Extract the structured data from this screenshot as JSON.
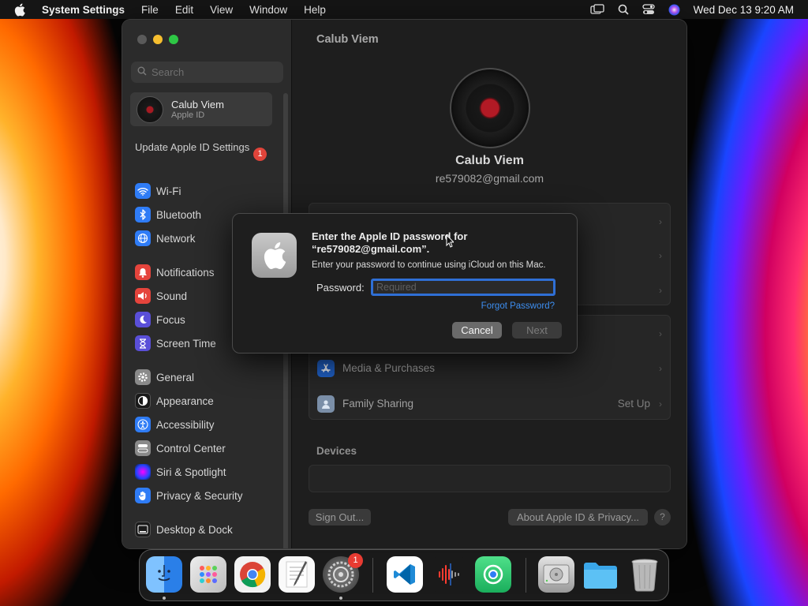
{
  "menubar": {
    "app_name": "System Settings",
    "items": [
      "File",
      "Edit",
      "View",
      "Window",
      "Help"
    ],
    "datetime": "Wed Dec 13  9:20 AM"
  },
  "sidebar": {
    "search_placeholder": "Search",
    "profile": {
      "name": "Calub Viem",
      "subtitle": "Apple ID"
    },
    "update_label": "Update Apple ID Settings",
    "update_badge": "1",
    "items": [
      {
        "label": "Wi-Fi",
        "icon": "wifi-icon",
        "color": "#2f7cf6"
      },
      {
        "label": "Bluetooth",
        "icon": "bluetooth-icon",
        "color": "#2f7cf6"
      },
      {
        "label": "Network",
        "icon": "globe-icon",
        "color": "#2f7cf6"
      },
      {
        "label": "Notifications",
        "icon": "bell-icon",
        "color": "#e5443c"
      },
      {
        "label": "Sound",
        "icon": "speaker-icon",
        "color": "#e5443c"
      },
      {
        "label": "Focus",
        "icon": "moon-icon",
        "color": "#5a4fd8"
      },
      {
        "label": "Screen Time",
        "icon": "hourglass-icon",
        "color": "#5a4fd8"
      },
      {
        "label": "General",
        "icon": "gear-icon",
        "color": "#8a8a8a"
      },
      {
        "label": "Appearance",
        "icon": "appearance-icon",
        "color": "#1a1a1a"
      },
      {
        "label": "Accessibility",
        "icon": "accessibility-icon",
        "color": "#2f7cf6"
      },
      {
        "label": "Control Center",
        "icon": "control-center-icon",
        "color": "#8a8a8a"
      },
      {
        "label": "Siri & Spotlight",
        "icon": "siri-icon",
        "color": "#2b2b2b"
      },
      {
        "label": "Privacy & Security",
        "icon": "hand-icon",
        "color": "#2f7cf6"
      },
      {
        "label": "Desktop & Dock",
        "icon": "dock-icon",
        "color": "#1a1a1a"
      }
    ]
  },
  "content": {
    "title": "Calub Viem",
    "name": "Calub Viem",
    "email": "re579082@gmail.com",
    "rows": [
      {
        "label": "Media & Purchases",
        "icon": "app-store-icon"
      },
      {
        "label": "Family Sharing",
        "icon": "family-icon",
        "right": "Set Up"
      }
    ],
    "devices_label": "Devices",
    "sign_out": "Sign Out...",
    "about": "About Apple ID & Privacy...",
    "help": "?"
  },
  "dialog": {
    "title": "Enter the Apple ID password for “re579082@gmail.com”.",
    "message": "Enter your password to continue using iCloud on this Mac.",
    "password_label": "Password:",
    "password_placeholder": "Required",
    "forgot": "Forgot Password?",
    "cancel": "Cancel",
    "next": "Next"
  },
  "dock": {
    "apps": [
      "finder-icon",
      "launchpad-icon",
      "chrome-icon",
      "textedit-icon",
      "system-settings-icon",
      "vscode-icon",
      "voice-memos-icon",
      "find-my-icon",
      "disk-utility-icon",
      "folder-icon",
      "trash-icon"
    ],
    "settings_badge": "1"
  }
}
